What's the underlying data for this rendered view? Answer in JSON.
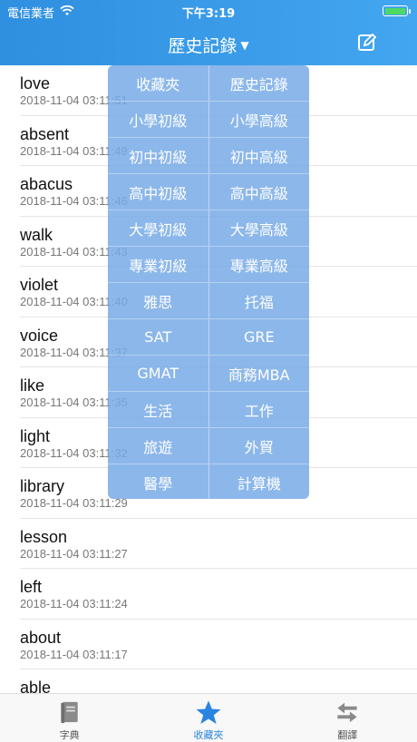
{
  "status": {
    "carrier": "電信業者",
    "time": "下午3:19"
  },
  "nav": {
    "title": "歷史記錄"
  },
  "list": [
    {
      "word": "love",
      "time": "2018-11-04 03:11:51"
    },
    {
      "word": "absent",
      "time": "2018-11-04 03:11:49"
    },
    {
      "word": "abacus",
      "time": "2018-11-04 03:11:46"
    },
    {
      "word": "walk",
      "time": "2018-11-04 03:11:43"
    },
    {
      "word": "violet",
      "time": "2018-11-04 03:11:40"
    },
    {
      "word": "voice",
      "time": "2018-11-04 03:11:37"
    },
    {
      "word": "like",
      "time": "2018-11-04 03:11:35"
    },
    {
      "word": "light",
      "time": "2018-11-04 03:11:32"
    },
    {
      "word": "library",
      "time": "2018-11-04 03:11:29"
    },
    {
      "word": "lesson",
      "time": "2018-11-04 03:11:27"
    },
    {
      "word": "left",
      "time": "2018-11-04 03:11:24"
    },
    {
      "word": "about",
      "time": "2018-11-04 03:11:17"
    },
    {
      "word": "able",
      "time": ""
    }
  ],
  "menu": [
    [
      "收藏夾",
      "歷史記錄"
    ],
    [
      "小學初級",
      "小學高級"
    ],
    [
      "初中初級",
      "初中高級"
    ],
    [
      "高中初級",
      "高中高級"
    ],
    [
      "大學初級",
      "大學高級"
    ],
    [
      "專業初級",
      "專業高級"
    ],
    [
      "雅思",
      "托福"
    ],
    [
      "SAT",
      "GRE"
    ],
    [
      "GMAT",
      "商務MBA"
    ],
    [
      "生活",
      "工作"
    ],
    [
      "旅遊",
      "外貿"
    ],
    [
      "醫學",
      "計算機"
    ]
  ],
  "tabs": [
    {
      "label": "字典",
      "icon": "book-icon"
    },
    {
      "label": "收藏夾",
      "icon": "star-icon"
    },
    {
      "label": "翻譯",
      "icon": "swap-arrows-icon"
    }
  ],
  "colors": {
    "header": "#3b9ded",
    "accent": "#2a85e0",
    "menu": "#78aae6"
  }
}
